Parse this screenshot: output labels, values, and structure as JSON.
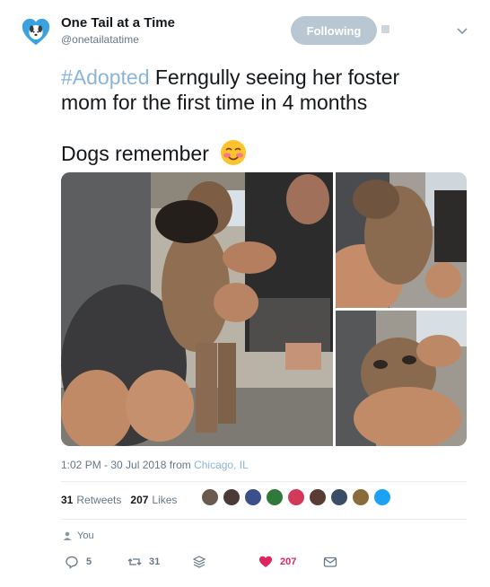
{
  "account": {
    "display_name": "One Tail at a Time",
    "handle": "@onetailatatime",
    "follow_label": "Following"
  },
  "tweet": {
    "hashtag": "#Adopted",
    "text_line1": " Ferngully seeing her foster",
    "text_line2": "mom for the first time in 4 months",
    "text_line3": "Dogs remember",
    "emoji": "smiling-face-with-blushed-cheeks"
  },
  "meta": {
    "time_prefix": "1:02 PM - 30 Jul 2018 from ",
    "location": "Chicago, IL"
  },
  "stats": {
    "retweets_count": "31",
    "retweets_label": "Retweets",
    "likes_count": "207",
    "likes_label": "Likes",
    "liker_avatars": [
      "#6b5a4e",
      "#4a3b36",
      "#3b4f8a",
      "#2f7a3a",
      "#d23a5a",
      "#5a3c34",
      "#3a4d66",
      "#8a6b3a",
      "#1da1f2"
    ]
  },
  "reply_context": {
    "label": "You"
  },
  "actions": {
    "replies": "5",
    "retweets": "31",
    "likes": "207"
  },
  "colors": {
    "accent": "#1da1f2",
    "link": "#8ab5d8",
    "like": "#e0245e",
    "following_button": "#b9c7d2"
  }
}
